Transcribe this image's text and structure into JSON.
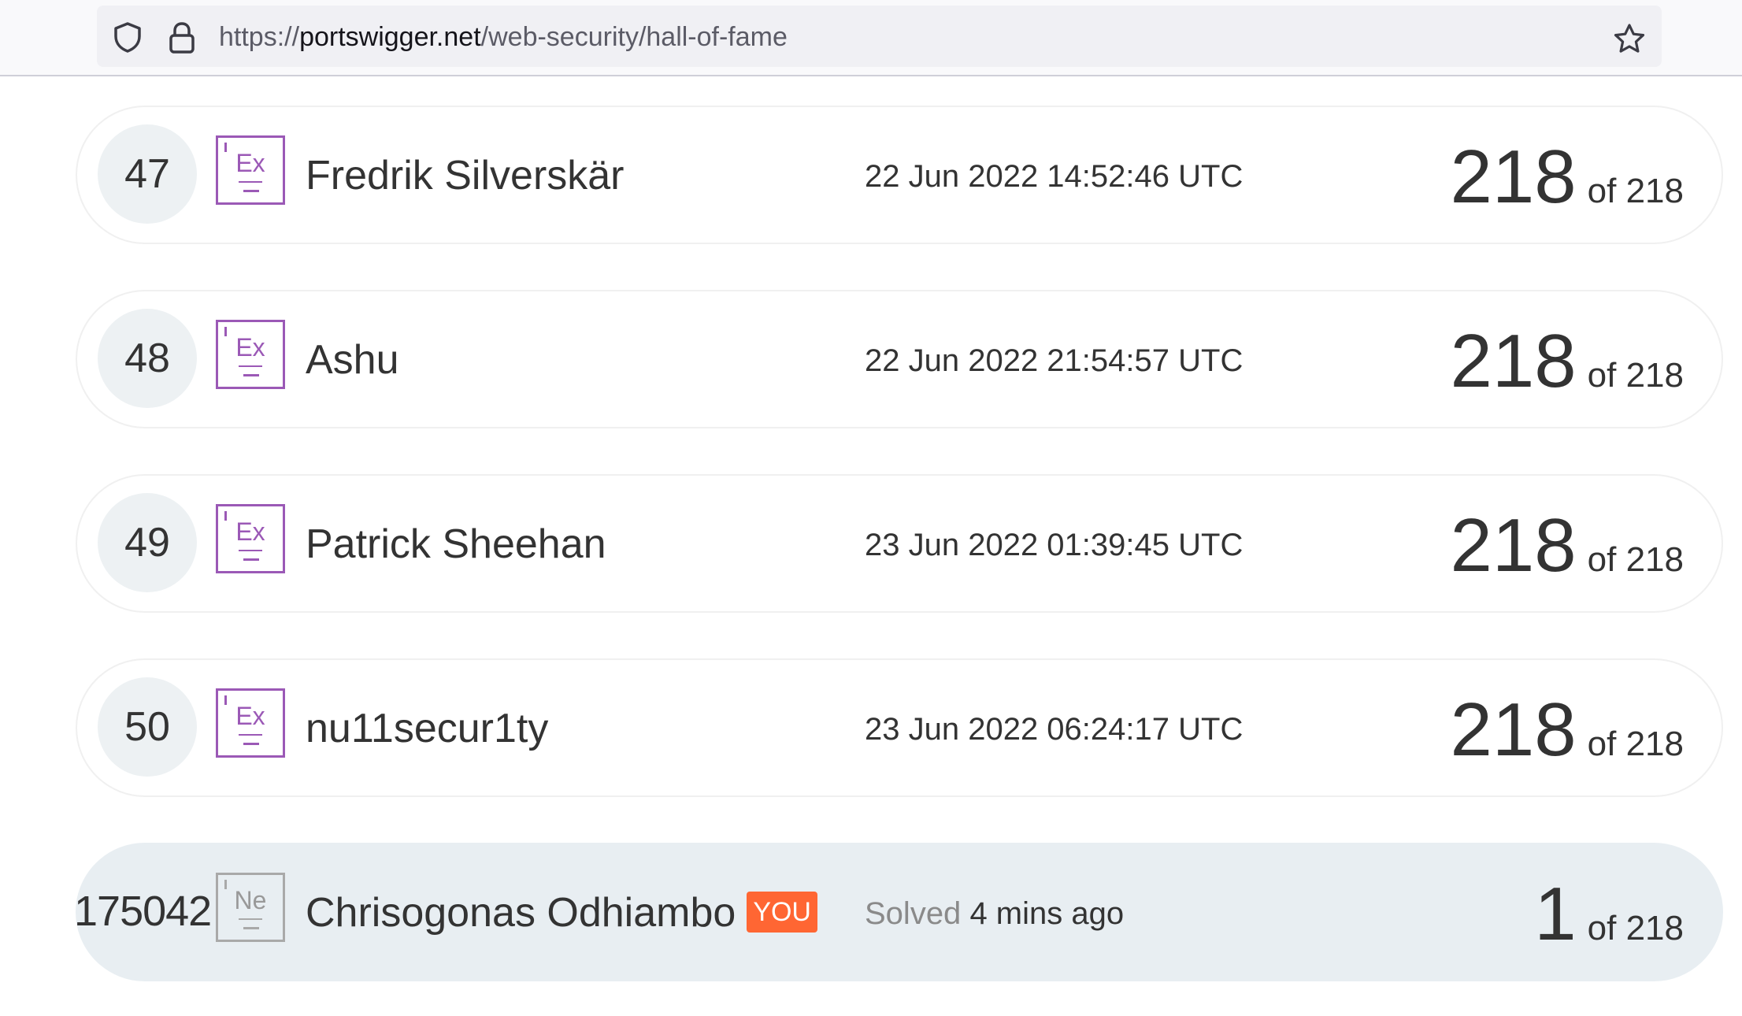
{
  "browser": {
    "url_scheme": "https://",
    "url_host": "portswigger.net",
    "url_path": "/web-security/hall-of-fame"
  },
  "entries": [
    {
      "rank": "47",
      "level": "Ex",
      "name": "Fredrik Silverskär",
      "date": "22 Jun 2022 14:52:46 UTC",
      "solved": "218",
      "total": "of 218"
    },
    {
      "rank": "48",
      "level": "Ex",
      "name": "Ashu",
      "date": "22 Jun 2022 21:54:57 UTC",
      "solved": "218",
      "total": "of 218"
    },
    {
      "rank": "49",
      "level": "Ex",
      "name": "Patrick Sheehan",
      "date": "23 Jun 2022 01:39:45 UTC",
      "solved": "218",
      "total": "of 218"
    },
    {
      "rank": "50",
      "level": "Ex",
      "name": "nu11secur1ty",
      "date": "23 Jun 2022 06:24:17 UTC",
      "solved": "218",
      "total": "of 218"
    }
  ],
  "me": {
    "rank": "175042",
    "level": "Ne",
    "name": "Chrisogonas Odhiambo",
    "you_badge": "YOU",
    "solved_label": "Solved",
    "solved_time": "4 mins ago",
    "solved": "1",
    "total": "of 218"
  },
  "colors": {
    "expert_badge": "#9b59b6",
    "newcomer_badge": "#a9a9a9",
    "you_badge": "#ff6633",
    "me_row_bg": "#e8eef2"
  },
  "icons": [
    "shield-icon",
    "lock-icon",
    "star-icon",
    "level-badge-icon"
  ]
}
